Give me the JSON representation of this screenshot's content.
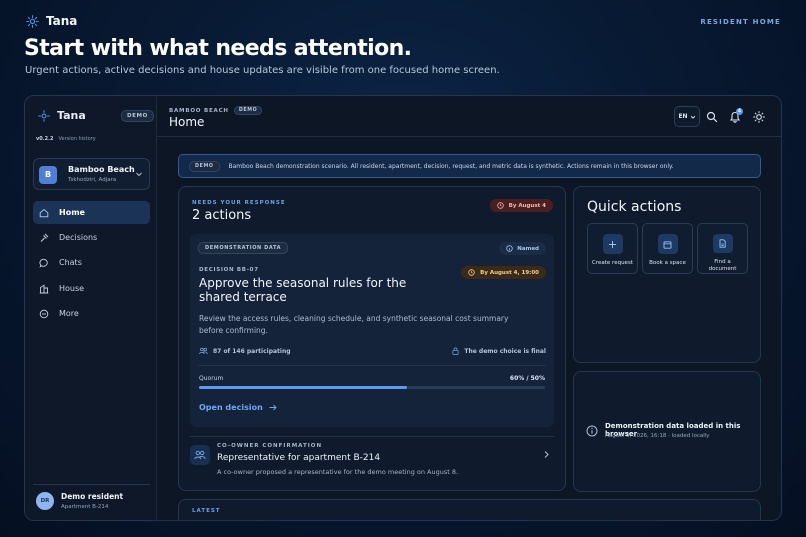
{
  "top": {
    "brand": "Tana",
    "section_label": "RESIDENT HOME",
    "hero_title": "Start with what needs attention.",
    "hero_subtitle": "Urgent actions, active decisions and house updates are visible from one focused home screen."
  },
  "sidebar": {
    "brand": "Tana",
    "demo_badge": "DEMO",
    "version": "v0.2.2",
    "version_link": "Version history",
    "space": {
      "avatar": "B",
      "name": "Bamboo Beach",
      "location": "Tskhodziri, Adjara"
    },
    "nav": [
      {
        "label": "Home",
        "icon": "home-icon"
      },
      {
        "label": "Decisions",
        "icon": "gavel-icon"
      },
      {
        "label": "Chats",
        "icon": "chat-icon"
      },
      {
        "label": "House",
        "icon": "building-icon"
      },
      {
        "label": "More",
        "icon": "more-icon"
      }
    ],
    "user": {
      "initials": "DR",
      "name": "Demo resident",
      "apartment": "Apartment B-214"
    }
  },
  "header": {
    "breadcrumb": "BAMBOO BEACH",
    "breadcrumb_badge": "DEMO",
    "title": "Home",
    "language": "EN",
    "notification_count": "4"
  },
  "banner": {
    "badge": "DEMO",
    "text": "Bamboo Beach demonstration scenario. All resident, apartment, decision, request, and metric data is synthetic. Actions remain in this browser only."
  },
  "needs": {
    "eyebrow": "NEEDS YOUR RESPONSE",
    "title": "2 actions",
    "deadline": "By August 4",
    "decision": {
      "tag": "DEMONSTRATION DATA",
      "named": "Named",
      "id": "DECISION BB-07",
      "deadline": "By August 4, 19:00",
      "title": "Approve the seasonal rules for the shared terrace",
      "description": "Review the access rules, cleaning schedule, and synthetic seasonal cost summary before confirming.",
      "participation": "87 of 146 participating",
      "final_note": "The demo choice is final",
      "quorum_label": "Quorum",
      "quorum_value": "60% / 50%",
      "quorum_progress": 0.6,
      "open_label": "Open decision"
    },
    "coowner": {
      "eyebrow": "CO-OWNER CONFIRMATION",
      "title": "Representative for apartment B-214",
      "description": "A co-owner proposed a representative for the demo meeting on August 8."
    }
  },
  "quick_actions": {
    "title": "Quick actions",
    "items": [
      {
        "label": "Create request",
        "icon": "plus-icon"
      },
      {
        "label": "Book a space",
        "icon": "calendar-icon"
      },
      {
        "label": "Find a document",
        "icon": "document-icon"
      }
    ]
  },
  "status": {
    "title": "Demonstration data loaded in this browser",
    "subtitle": "August 3, 2026, 16:18 · loaded locally"
  },
  "latest": {
    "eyebrow": "LATEST"
  },
  "colors": {
    "accent": "#5e9bf0",
    "background": "#081a33",
    "urgent_pill": "#4a1f22",
    "warning_pill": "#3b2a17"
  }
}
